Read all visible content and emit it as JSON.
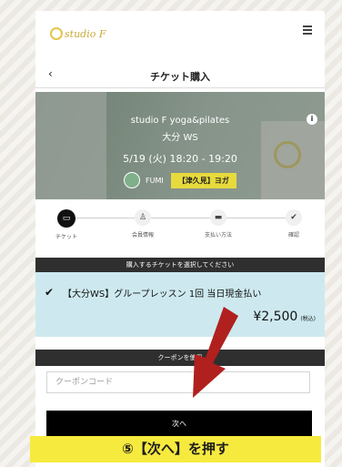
{
  "header": {
    "logo_text": "studio F",
    "logo_icon": "studio-f-logo",
    "menu_icon": "hamburger-menu-icon"
  },
  "page": {
    "back_icon": "chevron-left-icon",
    "back_glyph": "‹",
    "title": "チケット購入"
  },
  "lesson": {
    "studio": "studio F yoga&pilates",
    "name": "大分 WS",
    "datetime": "5/19 (火) 18:20 - 19:20",
    "instructor": "FUMI",
    "category_badge": "【津久見】ヨガ",
    "info_glyph": "i"
  },
  "steps": [
    {
      "label": "チケット",
      "icon": "ticket-icon",
      "glyph": "▭",
      "active": true
    },
    {
      "label": "会員情報",
      "icon": "person-icon",
      "glyph": "♙",
      "active": false
    },
    {
      "label": "支払い方法",
      "icon": "credit-card-icon",
      "glyph": "▬",
      "active": false
    },
    {
      "label": "確認",
      "icon": "check-icon",
      "glyph": "✔",
      "active": false
    }
  ],
  "ticket_section": {
    "header": "購入するチケットを選択してください",
    "selected_glyph": "✔",
    "ticket_name": "【大分WS】グループレッスン 1回 当日現金払い",
    "price": "¥2,500",
    "tax_note": "(税込)"
  },
  "coupon_section": {
    "header": "クーポンを使用",
    "placeholder": "クーポンコード",
    "value": ""
  },
  "next_button": "次へ",
  "instruction_overlay": "⑤【次へ】を押す",
  "colors": {
    "accent_yellow": "#e7da3c",
    "instruction_yellow": "#f7ea3f",
    "ticket_bg": "#cde9ef",
    "arrow_red": "#b0201e",
    "dark_band": "#2f2f2f"
  }
}
